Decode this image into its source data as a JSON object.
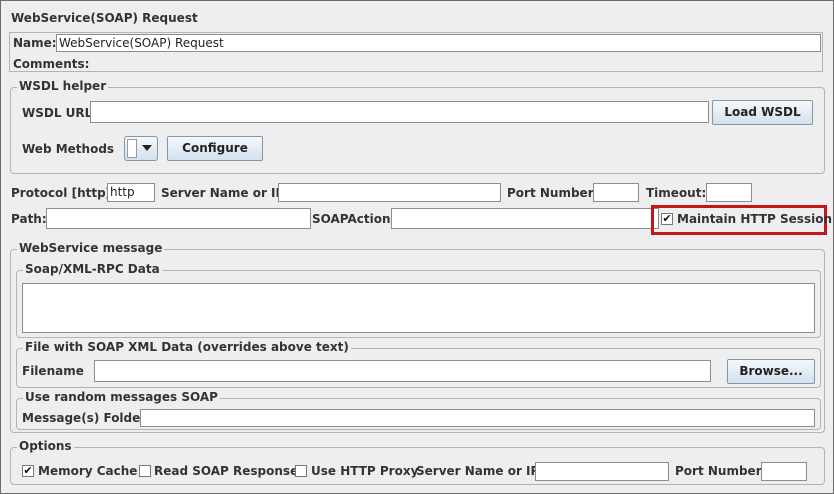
{
  "title": "WebService(SOAP) Request",
  "name": {
    "label": "Name:",
    "value": "WebService(SOAP) Request"
  },
  "comments": {
    "label": "Comments:"
  },
  "wsdl": {
    "legend": "WSDL helper",
    "url_label": "WSDL URL",
    "url_value": "",
    "load_button": "Load WSDL",
    "methods_label": "Web Methods",
    "configure_button": "Configure"
  },
  "connection": {
    "protocol_label": "Protocol [http]:",
    "protocol_value": "http",
    "server_label": "Server Name or IP:",
    "port_label": "Port Number:",
    "timeout_label": "Timeout:",
    "path_label": "Path:",
    "soapaction_label": "SOAPAction",
    "maintain_label": "Maintain HTTP Session",
    "maintain_checked": "✔"
  },
  "message": {
    "legend": "WebService message",
    "soap_legend": "Soap/XML-RPC Data",
    "file_legend": "File with SOAP XML Data (overrides above text)",
    "filename_label": "Filename",
    "browse_button": "Browse...",
    "random_legend": "Use random messages SOAP",
    "folder_label": "Message(s) Folder"
  },
  "options": {
    "legend": "Options",
    "memory_cache_label": "Memory Cache",
    "memory_cache_checked": "✔",
    "read_soap_label": "Read SOAP Response",
    "use_proxy_label": "Use HTTP Proxy",
    "server_label": "Server Name or IP:",
    "port_label": "Port Number:"
  },
  "colors": {
    "highlight": "#c0161c",
    "button_border": "#8596a8"
  },
  "icons": {
    "dropdown": "chevron-down-icon",
    "check": "checkmark-icon"
  }
}
